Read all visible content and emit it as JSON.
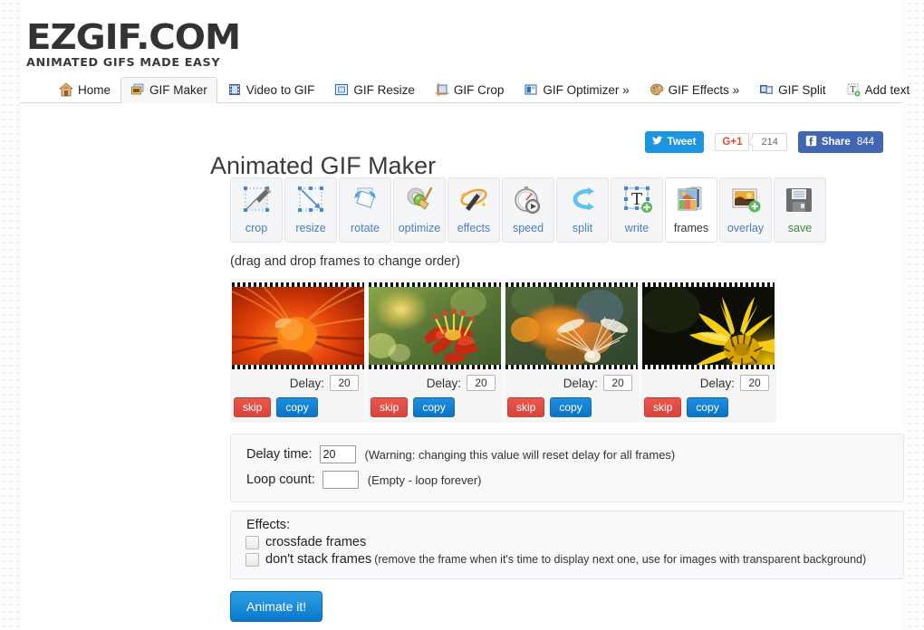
{
  "site": {
    "logo_main": "EZGIF.COM",
    "logo_sub": "ANIMATED GIFS MADE EASY"
  },
  "nav": {
    "items": [
      {
        "label": "Home",
        "icon": "home-icon",
        "active": false
      },
      {
        "label": "GIF Maker",
        "icon": "gif-maker-icon",
        "active": true
      },
      {
        "label": "Video to GIF",
        "icon": "video-icon",
        "active": false
      },
      {
        "label": "GIF Resize",
        "icon": "resize-icon",
        "active": false
      },
      {
        "label": "GIF Crop",
        "icon": "crop-icon",
        "active": false
      },
      {
        "label": "GIF Optimizer »",
        "icon": "optimizer-icon",
        "active": false
      },
      {
        "label": "GIF Effects »",
        "icon": "effects-palette-icon",
        "active": false
      },
      {
        "label": "GIF Split",
        "icon": "split-icon",
        "active": false
      },
      {
        "label": "Add text",
        "icon": "add-text-icon",
        "active": false
      }
    ]
  },
  "header": {
    "title": "Animated GIF Maker"
  },
  "social": {
    "tweet_label": "Tweet",
    "gplus_label": "G+1",
    "gplus_count": "214",
    "fb_label": "Share",
    "fb_count": "844"
  },
  "toolbar": {
    "items": [
      {
        "label": "crop",
        "icon": "crop-tool-icon",
        "state": "normal"
      },
      {
        "label": "resize",
        "icon": "resize-tool-icon",
        "state": "normal"
      },
      {
        "label": "rotate",
        "icon": "rotate-tool-icon",
        "state": "normal"
      },
      {
        "label": "optimize",
        "icon": "optimize-tool-icon",
        "state": "normal"
      },
      {
        "label": "effects",
        "icon": "effects-tool-icon",
        "state": "normal"
      },
      {
        "label": "speed",
        "icon": "speed-tool-icon",
        "state": "normal"
      },
      {
        "label": "split",
        "icon": "split-tool-icon",
        "state": "normal"
      },
      {
        "label": "write",
        "icon": "write-tool-icon",
        "state": "normal"
      },
      {
        "label": "frames",
        "icon": "frames-tool-icon",
        "state": "active"
      },
      {
        "label": "overlay",
        "icon": "overlay-tool-icon",
        "state": "normal"
      },
      {
        "label": "save",
        "icon": "save-tool-icon",
        "state": "save"
      }
    ]
  },
  "frames_section": {
    "hint": "(drag and drop frames to change order)",
    "delay_label": "Delay:",
    "skip_label": "skip",
    "copy_label": "copy",
    "frames": [
      {
        "image": "orange-flower-macro",
        "delay": "20"
      },
      {
        "image": "red-zinnia-flower",
        "delay": "20"
      },
      {
        "image": "dandelion-seeds",
        "delay": "20"
      },
      {
        "image": "yellow-daisy-flower",
        "delay": "20"
      }
    ]
  },
  "settings": {
    "delay_time_label": "Delay time:",
    "delay_time_value": "20",
    "delay_time_note": "(Warning: changing this value will reset delay for all frames)",
    "loop_count_label": "Loop count:",
    "loop_count_value": "",
    "loop_count_note": "(Empty - loop forever)"
  },
  "effects": {
    "title": "Effects:",
    "crossfade_label": "crossfade frames",
    "crossfade_checked": false,
    "dont_stack_label": "don't stack frames",
    "dont_stack_note": "(remove the frame when it's time to display next one, use for images with transparent background)",
    "dont_stack_checked": false
  },
  "actions": {
    "animate_label": "Animate it!"
  }
}
